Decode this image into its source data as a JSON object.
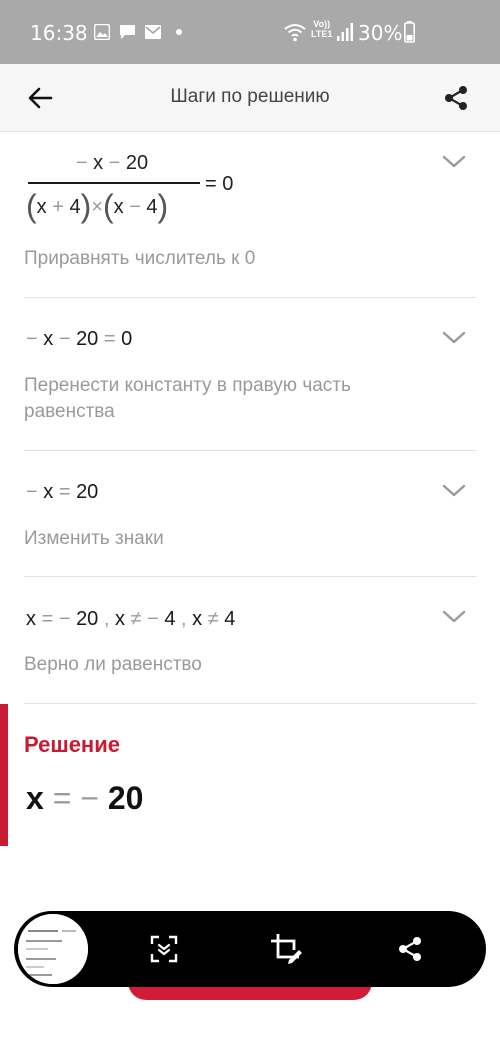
{
  "status_bar": {
    "time": "16:38",
    "network_top": "Vo))",
    "network_bottom": "LTE1",
    "battery": "30%"
  },
  "header": {
    "title": "Шаги по решению",
    "back_icon": "arrow-left-icon",
    "share_icon": "share-icon"
  },
  "steps": [
    {
      "numerator": [
        "−",
        "x",
        "−",
        "20"
      ],
      "denominator": [
        "(",
        "x",
        "+",
        "4",
        ")",
        "×",
        "(",
        "x",
        "−",
        "4",
        ")"
      ],
      "rhs": "= 0",
      "description": "Приравнять числитель к 0"
    },
    {
      "expr": [
        "−",
        "x",
        "−",
        "20",
        "=",
        "0"
      ],
      "description": "Перенести константу в правую часть равенства"
    },
    {
      "expr": [
        "−",
        "x",
        "=",
        "20"
      ],
      "description": "Изменить знаки"
    },
    {
      "expr": [
        "x",
        "=",
        "−",
        "20",
        ",",
        "x",
        "≠",
        "−",
        "4",
        ",",
        "x",
        "≠",
        "4"
      ],
      "description": "Верно ли равенство"
    }
  ],
  "solution": {
    "title": "Решение",
    "var": "x",
    "eq": "=",
    "minus": "−",
    "value": "20"
  },
  "colors": {
    "accent": "#c81a32",
    "status_bar": "#a9a9a9",
    "muted_text": "#9a9a9a"
  }
}
